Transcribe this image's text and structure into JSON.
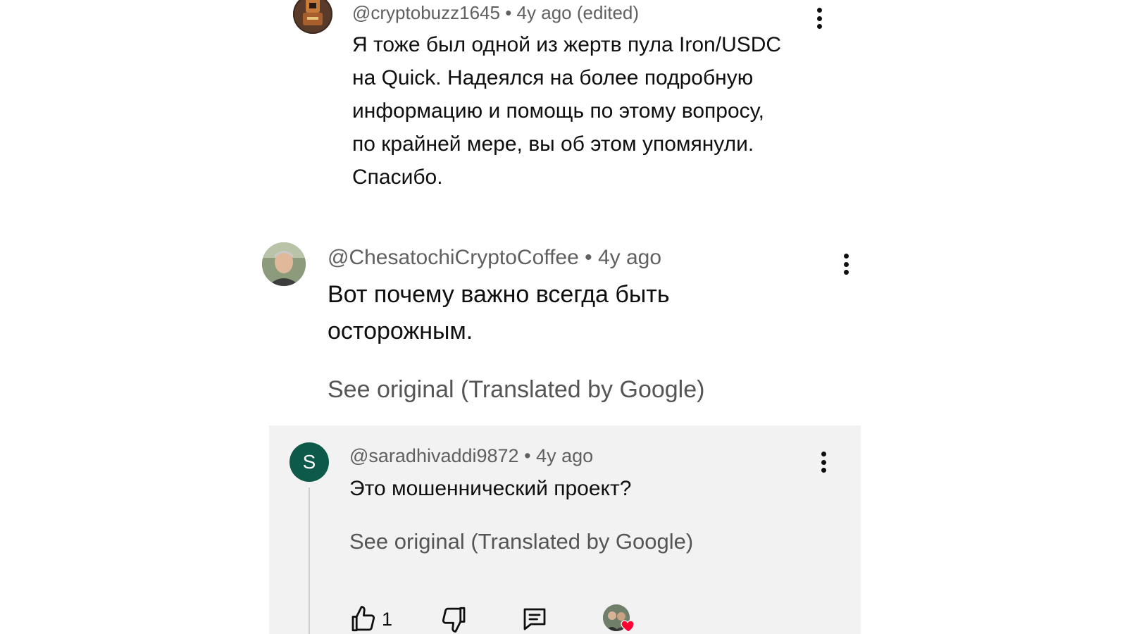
{
  "comments": [
    {
      "author": "@cryptobuzz1645",
      "time": "4y ago",
      "edited": "(edited)",
      "lines": [
        "Я тоже был одной из жертв пула Iron/USDC",
        "на Quick. Надеялся на более подробную",
        "информацию и помощь по этому вопросу,",
        "по крайней мере, вы об этом упомянули.",
        "Спасибо."
      ]
    },
    {
      "author": "@ChesatochiCryptoCoffee",
      "time": "4y ago",
      "lines": [
        "Вот почему важно всегда быть",
        "осторожным."
      ],
      "see_original": "See original (Translated by Google)"
    }
  ],
  "reply": {
    "avatar_letter": "S",
    "author": "@saradhivaddi9872",
    "time": "4y ago",
    "text": "Это мошеннический проект?",
    "see_original": "See original (Translated by Google)",
    "like_count": "1"
  },
  "separator": "•",
  "colors": {
    "reply_avatar": "#0e5a4a",
    "reply_panel": "#f2f2f2",
    "heart": "#ff0033",
    "meta_text": "#606060"
  },
  "icons": [
    "more-vert-icon",
    "thumbs-up-icon",
    "thumbs-down-icon",
    "reply-comment-icon",
    "creator-heart-icon"
  ]
}
